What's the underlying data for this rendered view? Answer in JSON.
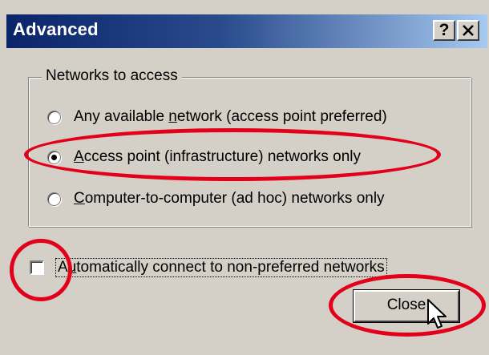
{
  "window": {
    "title": "Advanced",
    "help_button": "?",
    "close_button": "✕"
  },
  "networks_group": {
    "legend": "Networks to access",
    "options": [
      {
        "pre": "Any available ",
        "accel": "n",
        "post": "etwork (access point preferred)",
        "checked": false
      },
      {
        "pre": "",
        "accel": "A",
        "post": "ccess point (infrastructure) networks only",
        "checked": true
      },
      {
        "pre": "",
        "accel": "C",
        "post": "omputer-to-computer (ad hoc) networks only",
        "checked": false
      }
    ]
  },
  "auto_connect": {
    "pre": "A",
    "accel": "u",
    "post": "tomatically connect to non-preferred networks",
    "checked": false
  },
  "close_button": {
    "label": "Close"
  },
  "annotation_color": "#e3001b"
}
